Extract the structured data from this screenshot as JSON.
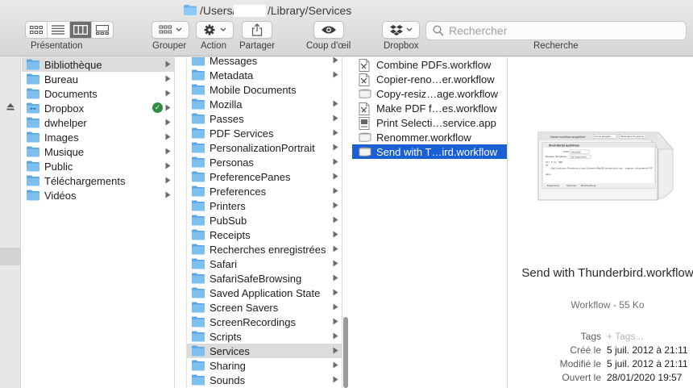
{
  "window": {
    "title_prefix": "/Users/",
    "title_suffix": "/Library/Services"
  },
  "toolbar": {
    "presentation_label": "Présentation",
    "group_label": "Grouper",
    "action_label": "Action",
    "share_label": "Partager",
    "quicklook_label": "Coup d'œil",
    "dropbox_label": "Dropbox",
    "search_label": "Recherche",
    "search_placeholder": "Rechercher",
    "view_modes": [
      "icon-view-icon",
      "list-view-icon",
      "column-view-icon",
      "gallery-view-icon"
    ],
    "active_view": "column-view-icon"
  },
  "sidebar_column": {
    "items": [
      {
        "label": "Bibliothèque",
        "icon": "folder-icon",
        "selected": true
      },
      {
        "label": "Bureau",
        "icon": "folder-icon"
      },
      {
        "label": "Documents",
        "icon": "folder-icon"
      },
      {
        "label": "Dropbox",
        "icon": "dropbox-folder-icon",
        "badge": "sync-ok"
      },
      {
        "label": "dwhelper",
        "icon": "folder-icon"
      },
      {
        "label": "Images",
        "icon": "folder-icon"
      },
      {
        "label": "Musique",
        "icon": "folder-icon"
      },
      {
        "label": "Public",
        "icon": "folder-icon"
      },
      {
        "label": "Téléchargements",
        "icon": "folder-icon"
      },
      {
        "label": "Vidéos",
        "icon": "folder-icon"
      }
    ]
  },
  "library_column": {
    "items": [
      {
        "label": "Messages"
      },
      {
        "label": "Metadata"
      },
      {
        "label": "Mobile Documents",
        "no_chevron": true
      },
      {
        "label": "Mozilla"
      },
      {
        "label": "Passes"
      },
      {
        "label": "PDF Services"
      },
      {
        "label": "PersonalizationPortrait"
      },
      {
        "label": "Personas"
      },
      {
        "label": "PreferencePanes"
      },
      {
        "label": "Preferences"
      },
      {
        "label": "Printers"
      },
      {
        "label": "PubSub"
      },
      {
        "label": "Receipts"
      },
      {
        "label": "Recherches enregistrées"
      },
      {
        "label": "Safari"
      },
      {
        "label": "SafariSafeBrowsing"
      },
      {
        "label": "Saved Application State"
      },
      {
        "label": "Screen Savers"
      },
      {
        "label": "ScreenRecordings"
      },
      {
        "label": "Scripts"
      },
      {
        "label": "Services",
        "selected": true
      },
      {
        "label": "Sharing"
      },
      {
        "label": "Sounds"
      }
    ]
  },
  "services_column": {
    "items": [
      {
        "label": "Combine PDFs.workflow",
        "icon": "workflow-doc-icon"
      },
      {
        "label": "Copier-reno…er.workflow",
        "icon": "workflow-doc-icon"
      },
      {
        "label": "Copy-resiz…age.workflow",
        "icon": "workflow-plain-icon"
      },
      {
        "label": "Make PDF f…es.workflow",
        "icon": "workflow-doc-icon"
      },
      {
        "label": "Print Selecti…service.app",
        "icon": "app-icon"
      },
      {
        "label": "Renommer.workflow",
        "icon": "workflow-plain-icon"
      },
      {
        "label": "Send with T…ird.workflow",
        "icon": "workflow-plain-icon",
        "selected": true
      }
    ]
  },
  "preview": {
    "name": "Send with Thunderbird.workflow",
    "kind": "Workflow - 55 Ko",
    "thumbnail_text": {
      "top_label": "Dieser workflow ausgeführt",
      "field_a": "Keine Eingabe",
      "field_b": "Beliebiges Programm",
      "action_title": "Shell-Skript ausführen",
      "shell_label": "Shell:",
      "shell_value": "/bin/bash",
      "input_label": "Eingabe übergeben:",
      "input_value": "als Argumente",
      "code_line1": "for f in \"$@\"",
      "code_line2": "do",
      "code_line3": "/Applications/Thunderbird.app/Contents/MacOS/thunderbird-bin -compose attachment=\"$f\"",
      "code_line4": "done",
      "tabs": [
        "Ergebnisse",
        "Optionen",
        "Beschreibung"
      ]
    },
    "meta": [
      {
        "key": "Tags",
        "value": "+ Tags..."
      },
      {
        "key": "Créé le",
        "value": "5 juil. 2012 à 21:11"
      },
      {
        "key": "Modifié le",
        "value": "5 juil. 2012 à 21:11"
      },
      {
        "key": "Ouvert le",
        "value": "28/01/2020 19:57"
      }
    ]
  },
  "colors": {
    "selection_blue": "#1a5fd4",
    "folder_blue": "#6cb4ec",
    "sync_green": "#2f8f3c"
  }
}
